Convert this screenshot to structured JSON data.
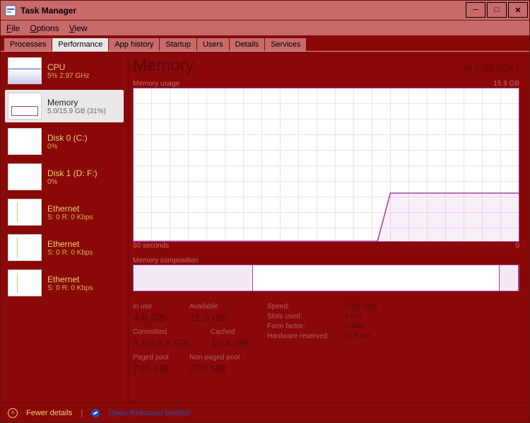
{
  "window": {
    "title": "Task Manager"
  },
  "menu": [
    "File",
    "Options",
    "View"
  ],
  "tabs": [
    "Processes",
    "Performance",
    "App history",
    "Startup",
    "Users",
    "Details",
    "Services"
  ],
  "active_tab": 1,
  "sidebar": [
    {
      "title": "CPU",
      "sub": "5%  2.97 GHz",
      "kind": "cpu"
    },
    {
      "title": "Memory",
      "sub": "5.0/15.9 GB (31%)",
      "kind": "mem",
      "selected": true
    },
    {
      "title": "Disk 0 (C:)",
      "sub": "0%",
      "kind": "disk"
    },
    {
      "title": "Disk 1 (D: F:)",
      "sub": "0%",
      "kind": "disk"
    },
    {
      "title": "Ethernet",
      "sub": "S: 0  R: 0 Kbps",
      "kind": "eth"
    },
    {
      "title": "Ethernet",
      "sub": "S: 0  R: 0 Kbps",
      "kind": "eth"
    },
    {
      "title": "Ethernet",
      "sub": "S: 0  R: 0 Kbps",
      "kind": "eth"
    }
  ],
  "header": {
    "title": "Memory",
    "capacity": "16.0 GB DDR3"
  },
  "usage_chart": {
    "label_left": "Memory usage",
    "label_right": "15.9 GB",
    "axis_left": "60 seconds",
    "axis_right": "0"
  },
  "composition": {
    "label": "Memory composition",
    "used_pct": 31,
    "gap_pct": 64,
    "rest_pct": 5
  },
  "stats": {
    "in_use": {
      "label": "In use",
      "value": "4.9 GB"
    },
    "available": {
      "label": "Available",
      "value": "11.0 GB"
    },
    "committed": {
      "label": "Committed",
      "value": "4.9/18.3 GB"
    },
    "cached": {
      "label": "Cached",
      "value": "10.4 GB"
    },
    "paged": {
      "label": "Paged pool",
      "value": "740 MB"
    },
    "nonpaged": {
      "label": "Non-paged pool",
      "value": "270 MB"
    }
  },
  "details": [
    {
      "k": "Speed:",
      "v": "1600 MHz"
    },
    {
      "k": "Slots used:",
      "v": "2 of 2"
    },
    {
      "k": "Form factor:",
      "v": "DIMM"
    },
    {
      "k": "Hardware reserved:",
      "v": "51.8 MB"
    }
  ],
  "footer": {
    "fewer": "Fewer details",
    "rm": "Open Resource Monitor"
  },
  "chart_data": {
    "type": "line",
    "title": "Memory usage",
    "xlabel": "seconds ago",
    "ylabel": "GB",
    "ylim": [
      0,
      15.9
    ],
    "x": [
      60,
      55,
      50,
      45,
      40,
      35,
      30,
      25,
      22,
      20,
      0
    ],
    "values": [
      0,
      0,
      0,
      0,
      0,
      0,
      0,
      0,
      0,
      5.0,
      5.0
    ]
  }
}
